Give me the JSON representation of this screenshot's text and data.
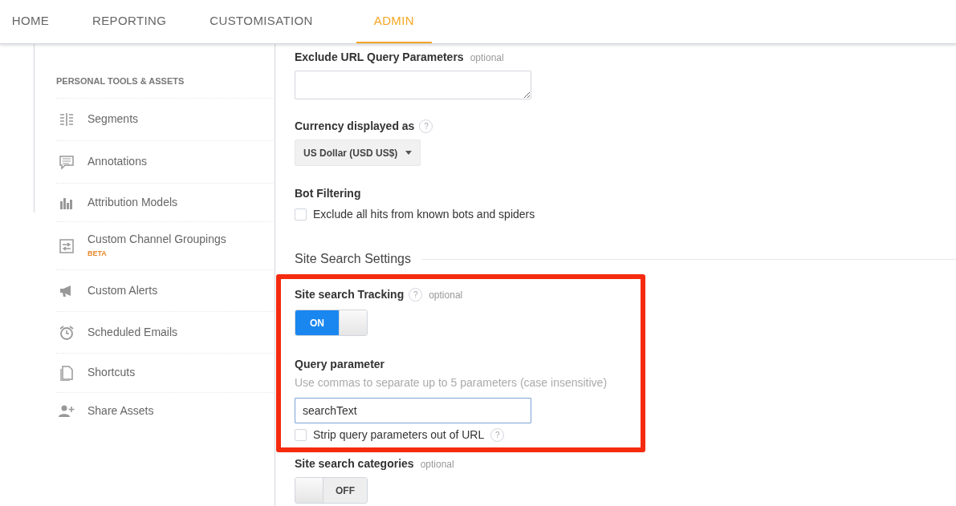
{
  "nav_tabs": [
    {
      "label": "HOME",
      "selected": false
    },
    {
      "label": "REPORTING",
      "selected": false
    },
    {
      "label": "CUSTOMISATION",
      "selected": false
    },
    {
      "label": "ADMIN",
      "selected": true
    }
  ],
  "sidebar": {
    "heading": "PERSONAL TOOLS & ASSETS",
    "items": [
      {
        "kind": "segments",
        "label": "Segments"
      },
      {
        "kind": "annotations",
        "label": "Annotations"
      },
      {
        "kind": "attribution",
        "label": "Attribution Models"
      },
      {
        "kind": "channels",
        "label": "Custom Channel Groupings",
        "badge": "BETA"
      },
      {
        "kind": "alerts",
        "label": "Custom Alerts"
      },
      {
        "kind": "scheduled",
        "label": "Scheduled Emails"
      },
      {
        "kind": "shortcuts",
        "label": "Shortcuts"
      },
      {
        "kind": "share",
        "label": "Share Assets"
      }
    ]
  },
  "exclude_params": {
    "label": "Exclude URL Query Parameters",
    "note": "optional"
  },
  "currency": {
    "label": "Currency displayed as",
    "help": "?",
    "value": "US Dollar (USD US$)"
  },
  "bot_filtering": {
    "label": "Bot Filtering",
    "checkbox": {
      "label": "Exclude all hits from known bots and spiders",
      "checked": false
    }
  },
  "site_search": {
    "heading": "Site Search Settings",
    "tracking": {
      "label": "Site search Tracking",
      "help": "?",
      "note": "optional",
      "on": true,
      "toggle_text": "ON"
    },
    "query_parameter": {
      "label": "Query parameter",
      "hint": "Use commas to separate up to 5 parameters (case insensitive)",
      "value": "searchText"
    },
    "strip": {
      "label": "Strip query parameters out of URL",
      "help": "?",
      "checked": false
    },
    "categories": {
      "label": "Site search categories",
      "note": "optional",
      "on": false,
      "toggle_text": "OFF"
    }
  }
}
